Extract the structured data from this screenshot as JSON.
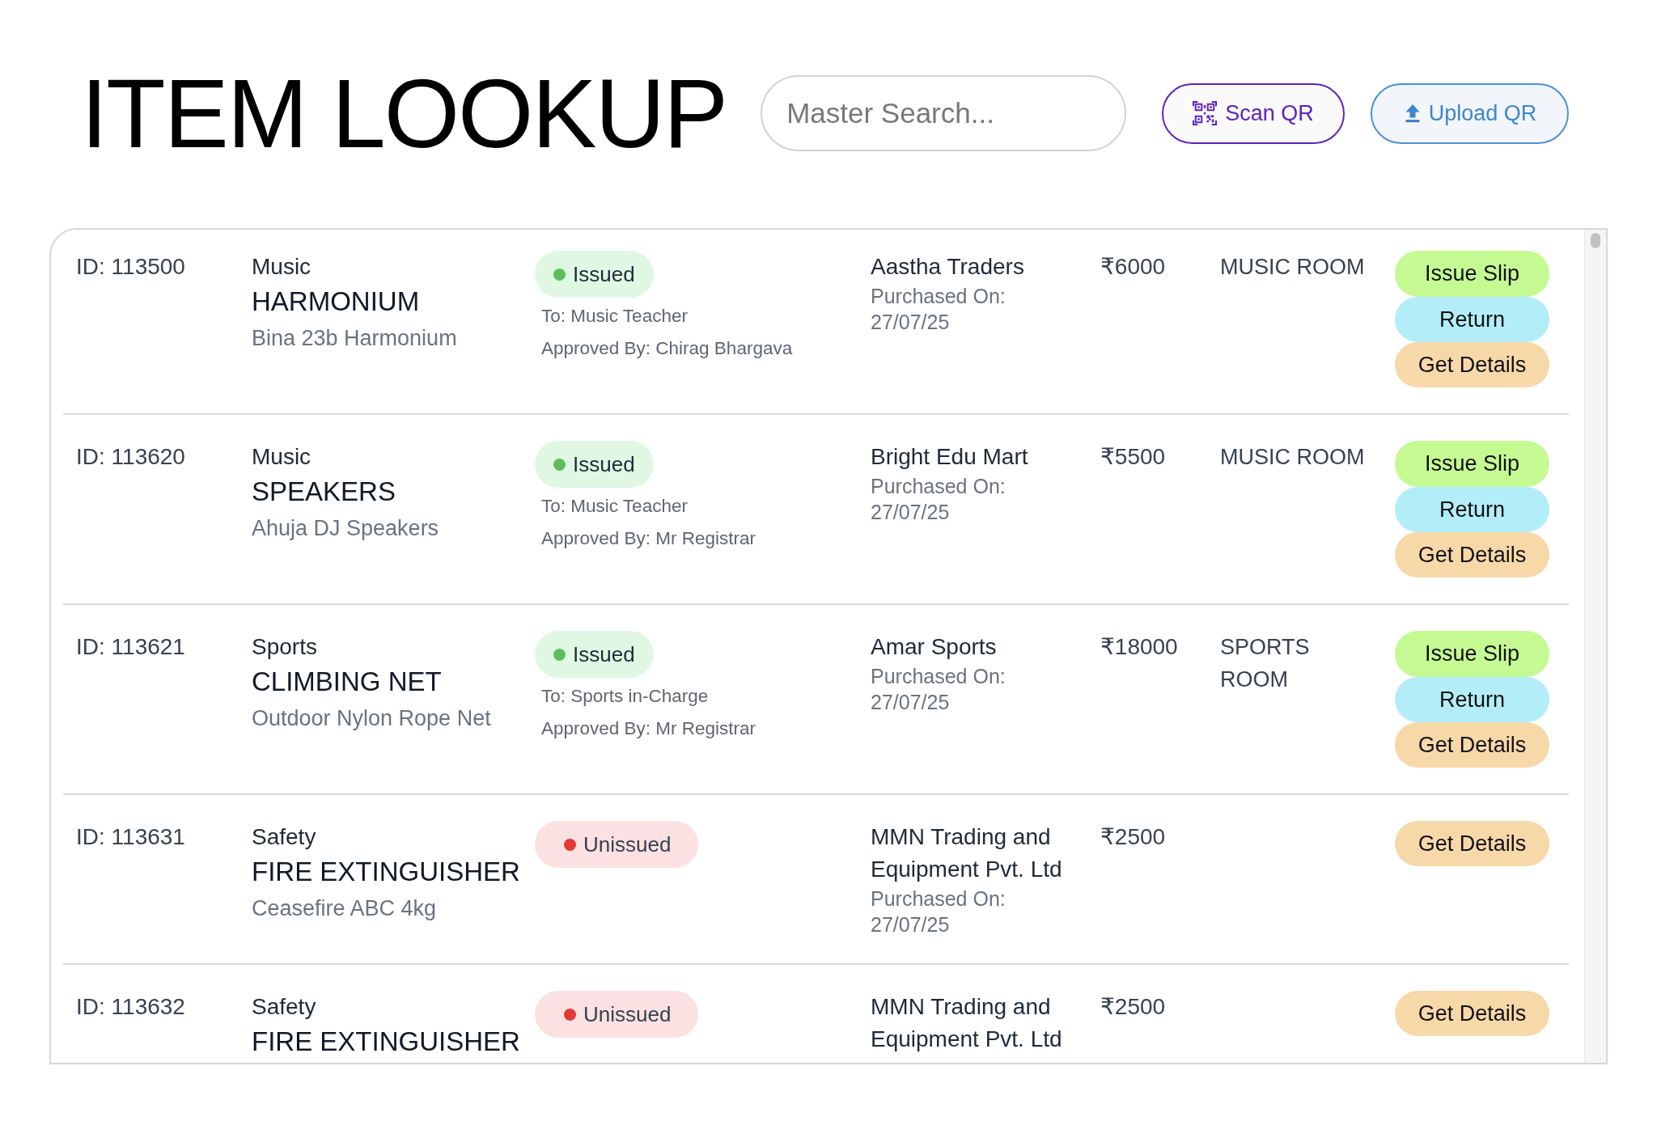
{
  "title": "ITEM LOOKUP",
  "search": {
    "placeholder": "Master Search..."
  },
  "header_buttons": [
    {
      "label": "Scan QR",
      "kind": "scan"
    },
    {
      "label": "Upload QR",
      "kind": "upload"
    }
  ],
  "items": [
    {
      "id": "ID: 113500",
      "category": "Music",
      "name": "HARMONIUM",
      "model": "Bina 23b Harmonium",
      "status": {
        "label": "Issued",
        "kind": "issued"
      },
      "issued_to": "To: Music Teacher",
      "approved_by": "Approved By: Chirag Bhargava",
      "vendor": "Aastha Traders",
      "purchased": {
        "label": "Purchased On:",
        "date": "27/07/25"
      },
      "price": "₹6000",
      "location": "MUSIC ROOM",
      "actions": [
        {
          "label": "Issue Slip",
          "kind": "issue"
        },
        {
          "label": "Return",
          "kind": "return"
        },
        {
          "label": "Get Details",
          "kind": "details"
        }
      ]
    },
    {
      "id": "ID: 113620",
      "category": "Music",
      "name": "SPEAKERS",
      "model": "Ahuja DJ Speakers",
      "status": {
        "label": "Issued",
        "kind": "issued"
      },
      "issued_to": "To: Music Teacher",
      "approved_by": "Approved By: Mr Registrar",
      "vendor": "Bright Edu Mart",
      "purchased": {
        "label": "Purchased On:",
        "date": "27/07/25"
      },
      "price": "₹5500",
      "location": "MUSIC ROOM",
      "actions": [
        {
          "label": "Issue Slip",
          "kind": "issue"
        },
        {
          "label": "Return",
          "kind": "return"
        },
        {
          "label": "Get Details",
          "kind": "details"
        }
      ]
    },
    {
      "id": "ID: 113621",
      "category": "Sports",
      "name": "CLIMBING NET",
      "model": "Outdoor Nylon Rope Net",
      "status": {
        "label": "Issued",
        "kind": "issued"
      },
      "issued_to": "To: Sports in-Charge",
      "approved_by": "Approved By: Mr Registrar",
      "vendor": "Amar Sports",
      "purchased": {
        "label": "Purchased On:",
        "date": "27/07/25"
      },
      "price": "₹18000",
      "location": "SPORTS ROOM",
      "actions": [
        {
          "label": "Issue Slip",
          "kind": "issue"
        },
        {
          "label": "Return",
          "kind": "return"
        },
        {
          "label": "Get Details",
          "kind": "details"
        }
      ]
    },
    {
      "id": "ID: 113631",
      "category": "Safety",
      "name": "FIRE EXTINGUISHER",
      "model": "Ceasefire ABC 4kg",
      "status": {
        "label": "Unissued",
        "kind": "unissued"
      },
      "vendor": "MMN Trading and Equipment Pvt. Ltd",
      "purchased": {
        "label": "Purchased On:",
        "date": "27/07/25"
      },
      "price": "₹2500",
      "actions": [
        {
          "label": "Get Details",
          "kind": "details"
        }
      ]
    },
    {
      "id": "ID: 113632",
      "category": "Safety",
      "name": "FIRE EXTINGUISHER",
      "status": {
        "label": "Unissued",
        "kind": "unissued"
      },
      "vendor": "MMN Trading and Equipment Pvt. Ltd",
      "price": "₹2500",
      "actions": [
        {
          "label": "Get Details",
          "kind": "details"
        }
      ]
    }
  ]
}
